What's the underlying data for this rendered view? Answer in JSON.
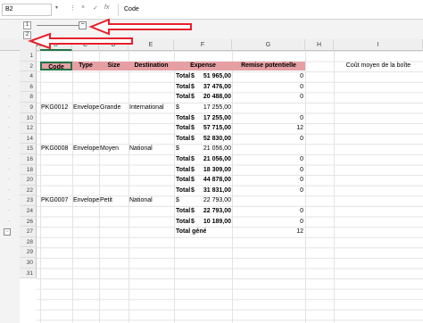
{
  "formula_bar": {
    "name_box": "B2",
    "cancel_icon": "×",
    "enter_icon": "✓",
    "fx_label": "fx",
    "formula": "Code"
  },
  "outline": {
    "col_levels": [
      "1",
      "2"
    ],
    "row_levels": [
      "1",
      "2"
    ],
    "collapse_symbol": "−"
  },
  "columns": [
    "A",
    "B",
    "C",
    "D",
    "E",
    "F",
    "G",
    "H",
    "I"
  ],
  "rows": [
    "1",
    "2",
    "4",
    "6",
    "8",
    "9",
    "10",
    "12",
    "14",
    "15",
    "16",
    "18",
    "20",
    "22",
    "23",
    "24",
    "26",
    "27",
    "28",
    "29",
    "30",
    "31"
  ],
  "headers": {
    "code": "Code",
    "type": "Type",
    "size": "Size",
    "destination": "Destination",
    "expense": "Expense",
    "remise": "Remise potentielle",
    "cout": "Coût moyen de la boîte"
  },
  "data_rows": [
    {
      "row": "4",
      "code": "",
      "type": "",
      "size": "",
      "dest": "",
      "label": "Total",
      "dollar": "$",
      "amount": "51 965,00",
      "remise": "0"
    },
    {
      "row": "6",
      "code": "",
      "type": "",
      "size": "",
      "dest": "",
      "label": "Total",
      "dollar": "$",
      "amount": "37 476,00",
      "remise": "0"
    },
    {
      "row": "8",
      "code": "",
      "type": "",
      "size": "",
      "dest": "",
      "label": "Total",
      "dollar": "$",
      "amount": "20 488,00",
      "remise": "0"
    },
    {
      "row": "9",
      "code": "PKG0012",
      "type": "Envelope",
      "size": "Grande",
      "dest": "International",
      "label": "",
      "dollar": "$",
      "amount": "17 255,00",
      "remise": ""
    },
    {
      "row": "10",
      "code": "",
      "type": "",
      "size": "",
      "dest": "",
      "label": "Total",
      "dollar": "$",
      "amount": "17 255,00",
      "remise": "0"
    },
    {
      "row": "12",
      "code": "",
      "type": "",
      "size": "",
      "dest": "",
      "label": "Total",
      "dollar": "$",
      "amount": "57 715,00",
      "remise": "12"
    },
    {
      "row": "14",
      "code": "",
      "type": "",
      "size": "",
      "dest": "",
      "label": "Total",
      "dollar": "$",
      "amount": "52 830,00",
      "remise": "0"
    },
    {
      "row": "15",
      "code": "PKG0008",
      "type": "Envelope",
      "size": "Moyen",
      "dest": "National",
      "label": "",
      "dollar": "$",
      "amount": "21 056,00",
      "remise": ""
    },
    {
      "row": "16",
      "code": "",
      "type": "",
      "size": "",
      "dest": "",
      "label": "Total",
      "dollar": "$",
      "amount": "21 056,00",
      "remise": "0"
    },
    {
      "row": "18",
      "code": "",
      "type": "",
      "size": "",
      "dest": "",
      "label": "Total",
      "dollar": "$",
      "amount": "18 309,00",
      "remise": "0"
    },
    {
      "row": "20",
      "code": "",
      "type": "",
      "size": "",
      "dest": "",
      "label": "Total",
      "dollar": "$",
      "amount": "44 878,00",
      "remise": "0"
    },
    {
      "row": "22",
      "code": "",
      "type": "",
      "size": "",
      "dest": "",
      "label": "Total",
      "dollar": "$",
      "amount": "31 831,00",
      "remise": "0"
    },
    {
      "row": "23",
      "code": "PKG0007",
      "type": "Envelope",
      "size": "Petit",
      "dest": "National",
      "label": "",
      "dollar": "$",
      "amount": "22 793,00",
      "remise": ""
    },
    {
      "row": "24",
      "code": "",
      "type": "",
      "size": "",
      "dest": "",
      "label": "Total",
      "dollar": "$",
      "amount": "22 793,00",
      "remise": "0"
    },
    {
      "row": "26",
      "code": "",
      "type": "",
      "size": "",
      "dest": "",
      "label": "Total",
      "dollar": "$",
      "amount": "10 189,00",
      "remise": "0"
    },
    {
      "row": "27",
      "code": "",
      "type": "",
      "size": "",
      "dest": "",
      "label": "Total général",
      "dollar": "",
      "amount": "",
      "remise": "12"
    }
  ],
  "colors": {
    "header_fill": "#e6a0a3",
    "selection": "#217346",
    "arrow": "#e8202a"
  }
}
